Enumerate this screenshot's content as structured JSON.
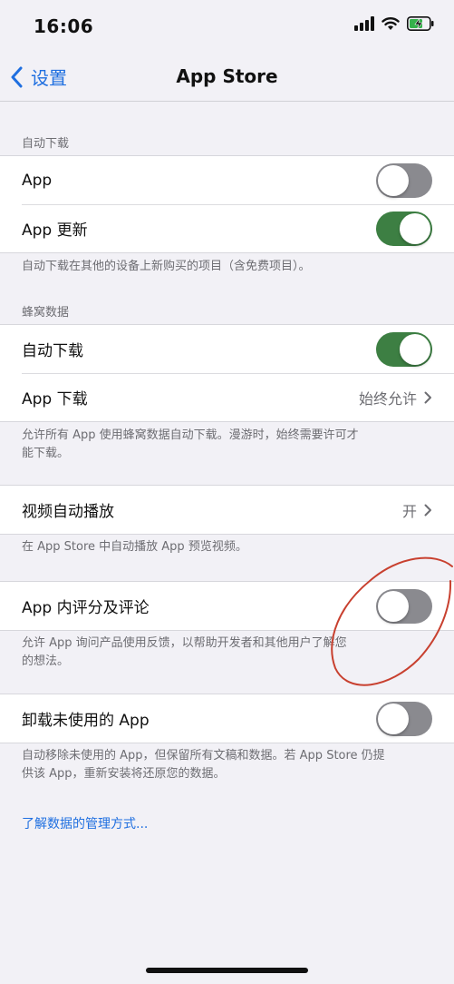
{
  "status_bar": {
    "time": "16:06",
    "icons": [
      "cellular-signal-icon",
      "wifi-icon",
      "battery-charging-icon"
    ]
  },
  "nav": {
    "back_label": "设置",
    "title": "App Store"
  },
  "auto_downloads": {
    "header": "自动下载",
    "rows": [
      {
        "label": "App",
        "toggle": "off"
      },
      {
        "label": "App 更新",
        "toggle": "on"
      }
    ],
    "footer": "自动下载在其他的设备上新购买的项目（含免费项目）。"
  },
  "cellular": {
    "header": "蜂窝数据",
    "rows": [
      {
        "label": "自动下载",
        "toggle": "on"
      },
      {
        "label": "App 下载",
        "value": "始终允许"
      }
    ],
    "footer_line1": "允许所有 App 使用蜂窝数据自动下载。漫游时，始终需要许可才",
    "footer_line2": "能下载。"
  },
  "video": {
    "row": {
      "label": "视频自动播放",
      "value": "开"
    },
    "footer": "在 App Store 中自动播放 App 预览视频。"
  },
  "ratings": {
    "row": {
      "label": "App 内评分及评论",
      "toggle": "off"
    },
    "footer_line1": "允许 App 询问产品使用反馈，以帮助开发者和其他用户了解您",
    "footer_line2": "的想法。"
  },
  "offload": {
    "row": {
      "label": "卸载未使用的 App",
      "toggle": "off"
    },
    "footer_line1": "自动移除未使用的 App，但保留所有文稿和数据。若 App Store 仍提",
    "footer_line2": "供该 App，重新安装将还原您的数据。"
  },
  "link": "了解数据的管理方式...",
  "colors": {
    "accent": "#1f6fe0",
    "toggle_on": "#3d7f43",
    "toggle_off": "#8a8a8f",
    "annotation": "#c8402f"
  }
}
